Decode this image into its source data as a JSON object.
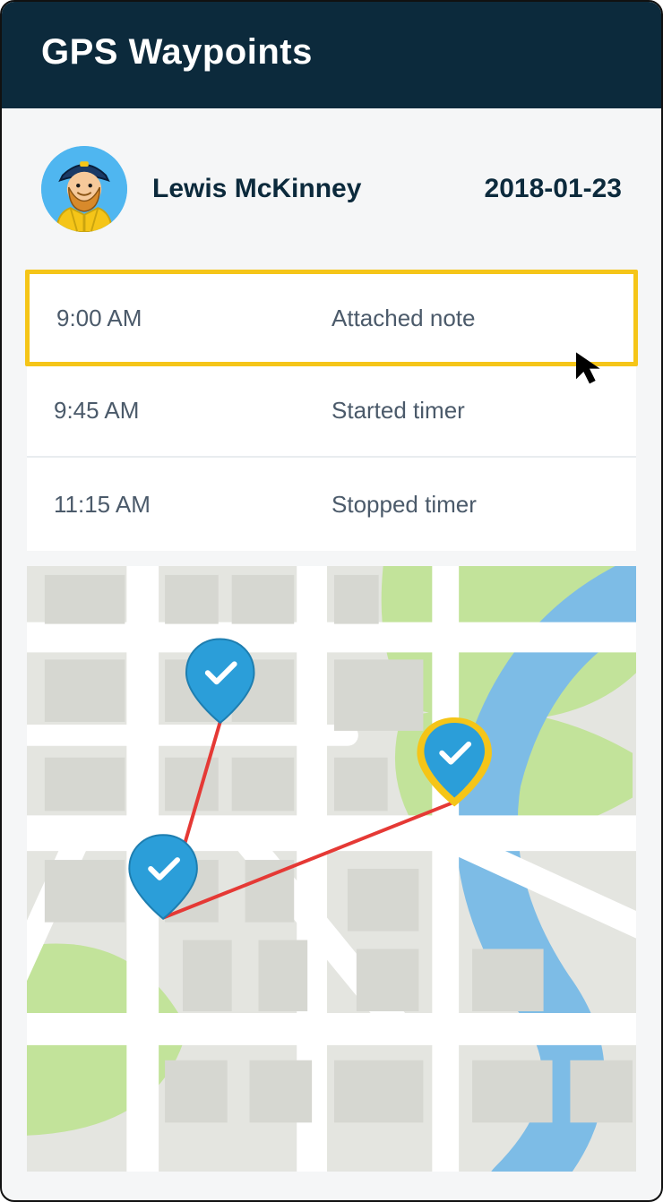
{
  "header": {
    "title": "GPS Waypoints"
  },
  "user": {
    "name": "Lewis McKinney",
    "date": "2018-01-23"
  },
  "waypoints": [
    {
      "time": "9:00 AM",
      "action": "Attached note",
      "selected": true
    },
    {
      "time": "9:45 AM",
      "action": "Started timer",
      "selected": false
    },
    {
      "time": "11:15 AM",
      "action": "Stopped timer",
      "selected": false
    }
  ],
  "map": {
    "pins": [
      {
        "id": "pin-1",
        "highlighted": false
      },
      {
        "id": "pin-2",
        "highlighted": false
      },
      {
        "id": "pin-3",
        "highlighted": true
      }
    ],
    "path_color": "#e53935"
  },
  "colors": {
    "header_bg": "#0c2a3c",
    "accent": "#f5c518",
    "pin": "#2b9ed9",
    "text": "#4b5a6a"
  }
}
